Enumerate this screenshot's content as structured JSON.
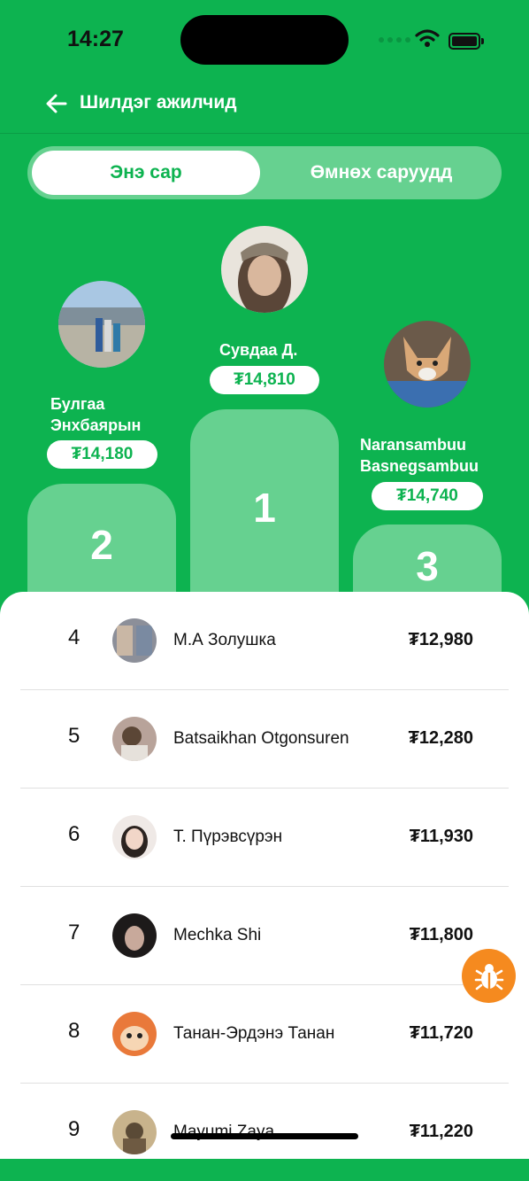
{
  "status_bar": {
    "time": "14:27"
  },
  "header": {
    "title": "Шилдэг ажилчид"
  },
  "tabs": [
    {
      "label": "Энэ сар",
      "active": true
    },
    {
      "label": "Өмнөх саруудд"
    }
  ],
  "podium": [
    {
      "rank": "1",
      "name": "Сувдаа Д.",
      "amount": "₮14,810"
    },
    {
      "rank": "2",
      "name_line1": "Булгаа",
      "name_line2": "Энхбаярын",
      "amount": "₮14,180"
    },
    {
      "rank": "3",
      "name_line1": "Naransambuu",
      "name_line2": "Basnegsambuu",
      "amount": "₮14,740"
    }
  ],
  "leaderboard": [
    {
      "rank": "4",
      "name": "М.А Золушка",
      "amount": "₮12,980"
    },
    {
      "rank": "5",
      "name": "Batsaikhan Otgonsuren",
      "amount": "₮12,280"
    },
    {
      "rank": "6",
      "name": "Т. Пүрэвсүрэн",
      "amount": "₮11,930"
    },
    {
      "rank": "7",
      "name": "Mechka Shi",
      "amount": "₮11,800"
    },
    {
      "rank": "8",
      "name": "Танан-Эрдэнэ Танан",
      "amount": "₮11,720"
    },
    {
      "rank": "9",
      "name": "Mayumi Zaya",
      "amount": "₮11,220"
    }
  ],
  "colors": {
    "brand_green": "#0db350",
    "light_green": "#66d190",
    "fab_orange": "#f58a1f"
  },
  "icons": {
    "back": "arrow-left-icon",
    "fab": "bug-icon"
  }
}
